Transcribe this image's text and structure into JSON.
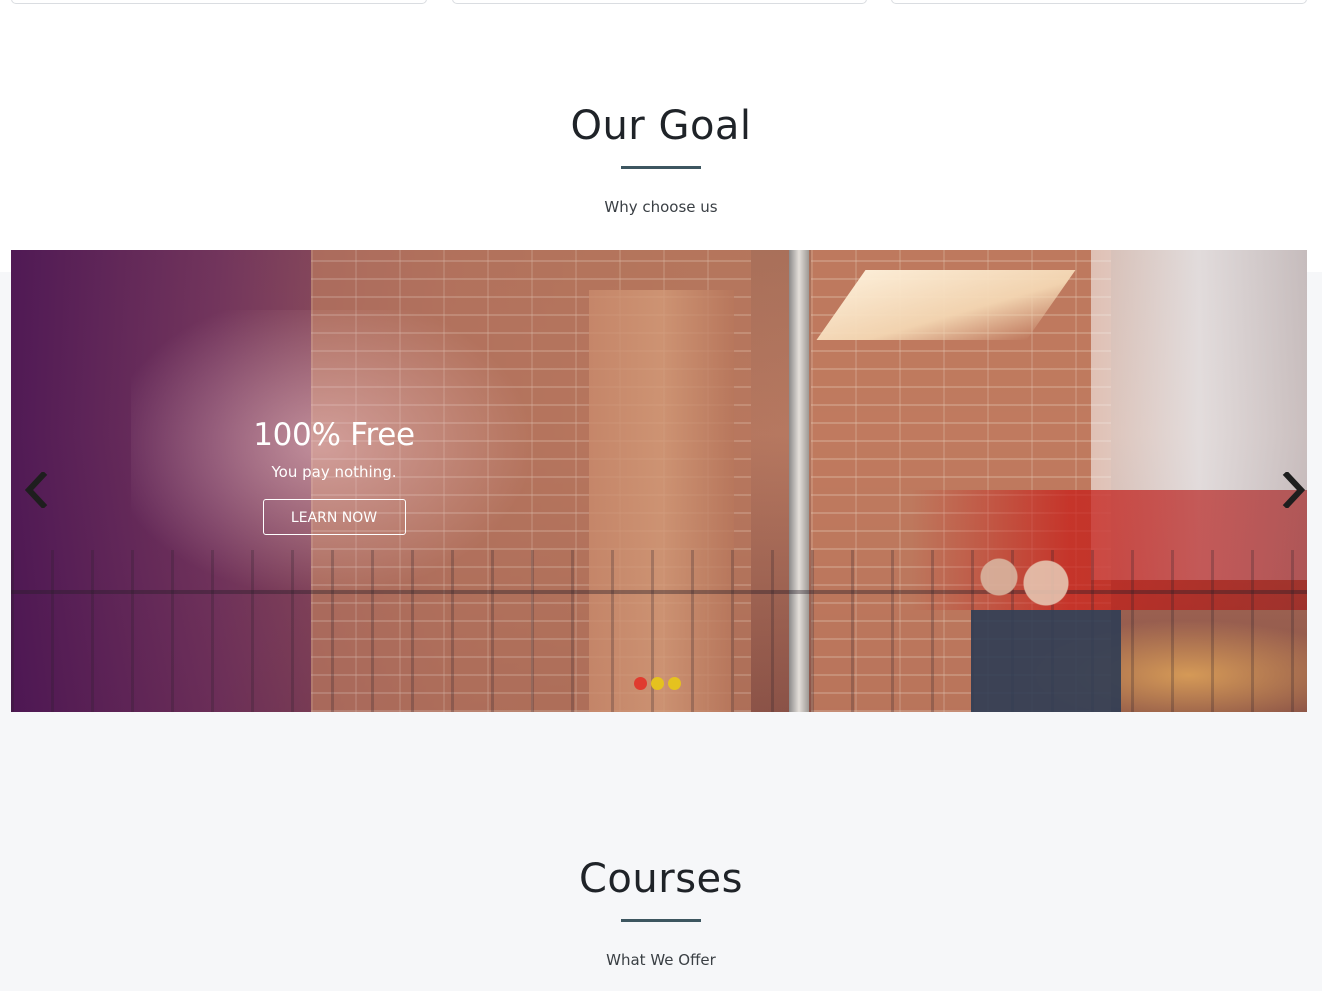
{
  "goal_section": {
    "title": "Our Goal",
    "subtitle": "Why choose us"
  },
  "carousel": {
    "slide_title": "100% Free",
    "slide_subtitle": "You pay nothing.",
    "cta_label": "LEARN NOW",
    "prev_icon": "chevron-left-icon",
    "next_icon": "chevron-right-icon",
    "slide_count": 3,
    "active_slide": 1,
    "dot_colors": [
      "#e03b2f",
      "#e5c21f",
      "#e5c21f"
    ]
  },
  "courses_section": {
    "title": "Courses",
    "subtitle": "What We Offer"
  },
  "colors": {
    "rule": "#3d5660",
    "grey_band": "#f6f7f9",
    "heading": "#1f2328"
  }
}
